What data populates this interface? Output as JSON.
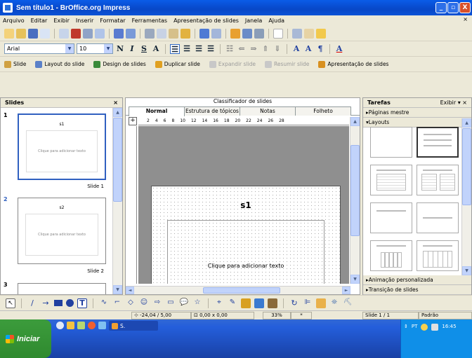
{
  "window": {
    "title": "Sem título1 - BrOffice.org Impress",
    "buttons": [
      "_",
      "▫",
      "X"
    ]
  },
  "menu": [
    "Arquivo",
    "Editar",
    "Exibir",
    "Inserir",
    "Formatar",
    "Ferramentas",
    "Apresentação de slides",
    "Janela",
    "Ajuda"
  ],
  "format_bar": {
    "font_name": "Arial",
    "font_size": "10"
  },
  "presentation_bar": {
    "items": [
      "Slide",
      "Layout do slide",
      "Design de slides",
      "Duplicar slide",
      "Expandir slide",
      "Resumir slide",
      "Apresentação de slides"
    ]
  },
  "slides_pane": {
    "title": "Slides",
    "close": "×",
    "thumbnails": [
      {
        "number": "1",
        "title": "s1",
        "body": "Clique para adicionar texto",
        "label": "Slide 1"
      },
      {
        "number": "2",
        "title": "s2",
        "body": "Clique para adicionar texto",
        "label": "Slide 2"
      },
      {
        "number": "3"
      }
    ]
  },
  "main_view": {
    "heading": "Classificador de slides",
    "tabs": [
      "Normal",
      "Estrutura de tópicos",
      "Notas",
      "Folheto"
    ],
    "active_tab": "Normal",
    "ruler_marks": [
      "2",
      "4",
      "6",
      "8",
      "10",
      "12",
      "14",
      "16",
      "18",
      "20",
      "22",
      "24",
      "26",
      "28"
    ],
    "slide_title": "s1",
    "slide_body": "Clique para adicionar texto"
  },
  "tasks_pane": {
    "title": "Tarefas",
    "view_menu": "Exibir",
    "sections": [
      "Páginas mestre",
      "Layouts",
      "Animação personalizada",
      "Transição de slides"
    ]
  },
  "status": {
    "position": "-24,04 / 5,00",
    "size": "0,00 x 0,00",
    "zoom": "33%",
    "modified": "*",
    "slide": "Slide 1 / 1",
    "layout": "Padrão"
  },
  "taskbar": {
    "start_label": "Iniciar",
    "task_label": "S.",
    "tray_lang": "PT",
    "tray_time": "16:45"
  },
  "colors": {
    "titlebar": "#0a52d6",
    "start": "#2f8a2f",
    "taskbar": "#245edb"
  }
}
